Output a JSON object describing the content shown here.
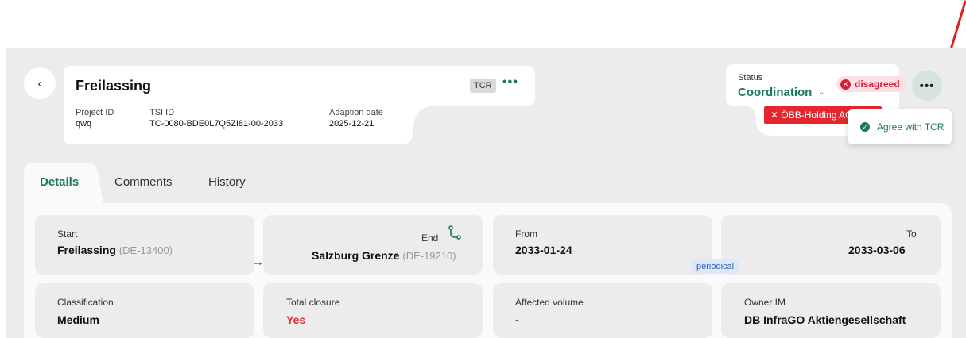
{
  "header": {
    "title": "Freilassing",
    "tag": "TCR",
    "more": "•••",
    "back_icon": "‹",
    "meta": [
      {
        "label": "Project ID",
        "value": "qwq"
      },
      {
        "label": "TSI ID",
        "value": "TC-0080-BDE0L7Q5ZI81-00-2033"
      },
      {
        "label": "Adaption date",
        "value": "2025-12-21"
      }
    ]
  },
  "status": {
    "label": "Status",
    "value": "Coordination",
    "chevron": "⌄",
    "badge": "disagreed",
    "badge_icon": "✕",
    "obb_label": "ÖBB-Holding AG",
    "obb_icon": "✕",
    "more": "•••"
  },
  "dropdown": {
    "items": [
      {
        "label": "Agree with TCR",
        "icon": "✓"
      }
    ]
  },
  "tabs": [
    {
      "label": "Details",
      "active": true
    },
    {
      "label": "Comments",
      "active": false
    },
    {
      "label": "History",
      "active": false
    }
  ],
  "details": {
    "start": {
      "label": "Start",
      "value": "Freilassing",
      "code": "(DE-13400)"
    },
    "end": {
      "label": "End",
      "value": "Salzburg Grenze",
      "code": "(DE-19210)"
    },
    "from": {
      "label": "From",
      "value": "2033-01-24"
    },
    "to": {
      "label": "To",
      "value": "2033-03-06"
    },
    "periodical": "periodical",
    "arrow": "→",
    "classification": {
      "label": "Classification",
      "value": "Medium"
    },
    "total_closure": {
      "label": "Total closure",
      "value": "Yes"
    },
    "affected_volume": {
      "label": "Affected volume",
      "value": "-"
    },
    "owner_im": {
      "label": "Owner IM",
      "value": "DB InfraGO Aktiengesellschaft"
    }
  },
  "colors": {
    "accent": "#1a7a56",
    "danger": "#e4262f",
    "badge_bg": "#fde0e3",
    "panel_bg": "#ececec"
  }
}
